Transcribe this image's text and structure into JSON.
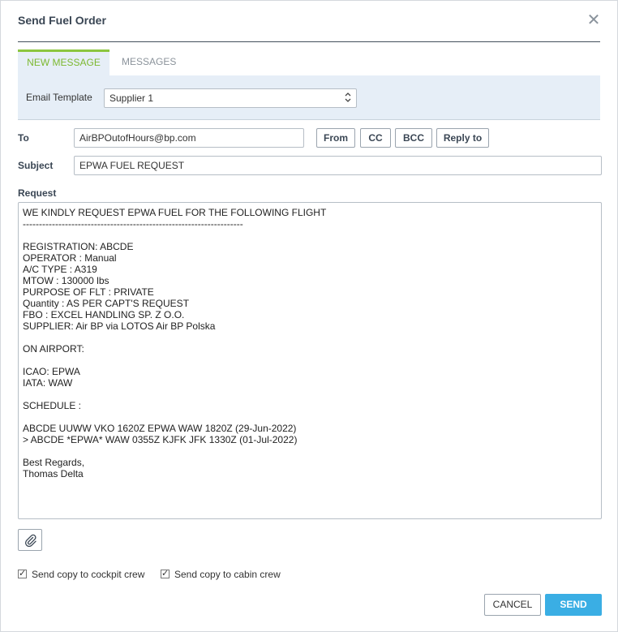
{
  "dialog": {
    "title": "Send Fuel Order",
    "close_glyph": "✕",
    "close_icon": "close-icon"
  },
  "tabs": [
    {
      "label": "NEW MESSAGE",
      "active": true
    },
    {
      "label": "MESSAGES",
      "active": false
    }
  ],
  "template": {
    "label": "Email Template",
    "selected": "Supplier 1"
  },
  "to": {
    "label": "To",
    "value": "AirBPOutofHours@bp.com",
    "buttons": [
      "From",
      "CC",
      "BCC",
      "Reply to"
    ]
  },
  "subject": {
    "label": "Subject",
    "value": "EPWA FUEL REQUEST"
  },
  "request": {
    "label": "Request",
    "body": "WE KINDLY REQUEST EPWA FUEL FOR THE FOLLOWING FLIGHT\n--------------------------------------------------------------------\n\nREGISTRATION: ABCDE\nOPERATOR : Manual\nA/C TYPE : A319\nMTOW : 130000 lbs\nPURPOSE OF FLT : PRIVATE\nQuantity : AS PER CAPT'S REQUEST\nFBO : EXCEL HANDLING SP. Z O.O.\nSUPPLIER: Air BP via LOTOS Air BP Polska\n\nON AIRPORT:\n\nICAO: EPWA\nIATA: WAW\n\nSCHEDULE :\n\nABCDE UUWW VKO 1620Z EPWA WAW 1820Z (29-Jun-2022)\n> ABCDE *EPWA* WAW 0355Z KJFK JFK 1330Z (01-Jul-2022)\n\nBest Regards,\nThomas Delta"
  },
  "checkboxes": [
    {
      "label": "Send copy to cockpit crew",
      "checked": true
    },
    {
      "label": "Send copy to cabin crew",
      "checked": true
    }
  ],
  "actions": {
    "cancel": "CANCEL",
    "send": "SEND"
  },
  "colors": {
    "accent_green": "#8cc63f",
    "primary_blue": "#3aaee4",
    "panel_bg": "#e6eef7"
  }
}
